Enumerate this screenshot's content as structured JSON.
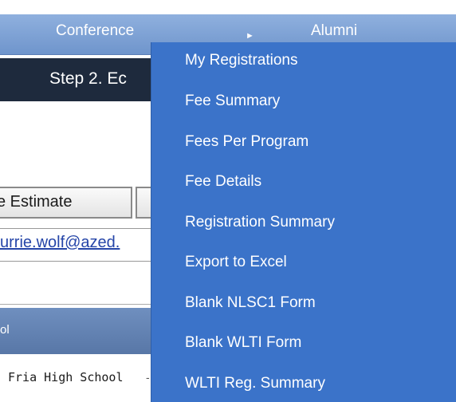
{
  "nav": {
    "conference": "Conference",
    "alumni": "Alumni",
    "arrow_icon": "►"
  },
  "step": {
    "title": "Step 2. Ec"
  },
  "buttons": {
    "estimate": "e Estimate"
  },
  "email": {
    "link": "urrie.wolf@azed."
  },
  "school": {
    "header": "ol",
    "row": "Fria High School"
  },
  "dropdown": {
    "items": [
      "My Registrations",
      "Fee Summary",
      "Fees Per Program",
      "Fee Details",
      "Registration Summary",
      "Export to Excel",
      "Blank NLSC1 Form",
      "Blank WLTI Form",
      "WLTI Reg. Summary"
    ]
  },
  "colors": {
    "menu_bg": "#3b73c9",
    "nav_bg": "#7a9fd4",
    "step_bg": "#1e2a3d",
    "link": "#2545a8"
  }
}
